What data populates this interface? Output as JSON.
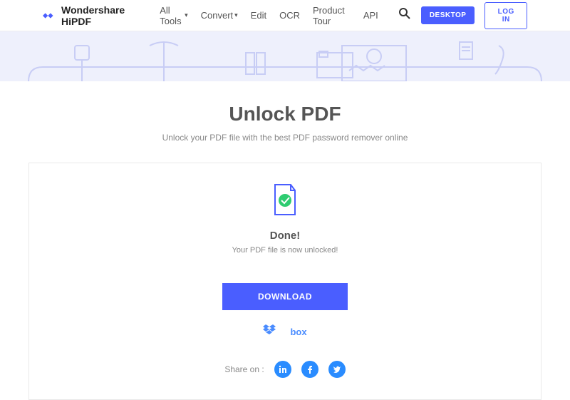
{
  "header": {
    "brand": "Wondershare HiPDF",
    "nav": {
      "allTools": "All Tools",
      "convert": "Convert",
      "edit": "Edit",
      "ocr": "OCR",
      "tour": "Product Tour",
      "api": "API"
    },
    "desktop": "DESKTOP",
    "login": "LOG IN"
  },
  "page": {
    "title": "Unlock PDF",
    "subtitle": "Unlock your PDF file with the best PDF password remover online"
  },
  "result": {
    "heading": "Done!",
    "message": "Your PDF file is now unlocked!",
    "download": "DOWNLOAD",
    "shareLabel": "Share on :"
  },
  "cloud": {
    "dropbox": "Dropbox",
    "box": "box"
  }
}
